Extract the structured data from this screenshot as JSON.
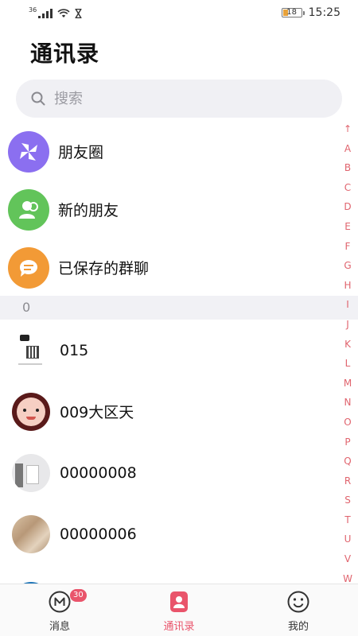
{
  "status": {
    "signal": "36",
    "battery": "18",
    "time": "15:25"
  },
  "title": "通讯录",
  "search": {
    "placeholder": "搜索"
  },
  "menu": [
    {
      "label": "朋友圈",
      "icon": "pinwheel-icon",
      "color": "#8b6ff0"
    },
    {
      "label": "新的朋友",
      "icon": "add-friend-icon",
      "color": "#62c45a"
    },
    {
      "label": "已保存的群聊",
      "icon": "group-chat-icon",
      "color": "#f29a36"
    }
  ],
  "section": "0",
  "contacts": [
    {
      "name": "015"
    },
    {
      "name": "009大区天"
    },
    {
      "name": "00000008"
    },
    {
      "name": "00000006"
    }
  ],
  "index": [
    "↑",
    "A",
    "B",
    "C",
    "D",
    "E",
    "F",
    "G",
    "H",
    "I",
    "J",
    "K",
    "L",
    "M",
    "N",
    "O",
    "P",
    "Q",
    "R",
    "S",
    "T",
    "U",
    "V",
    "W"
  ],
  "tabs": [
    {
      "label": "消息",
      "badge": "30",
      "icon": "message-icon"
    },
    {
      "label": "通讯录",
      "icon": "contacts-icon"
    },
    {
      "label": "我的",
      "icon": "smiley-icon"
    }
  ],
  "colors": {
    "accent": "#e9546b",
    "index": "#e0646e"
  }
}
